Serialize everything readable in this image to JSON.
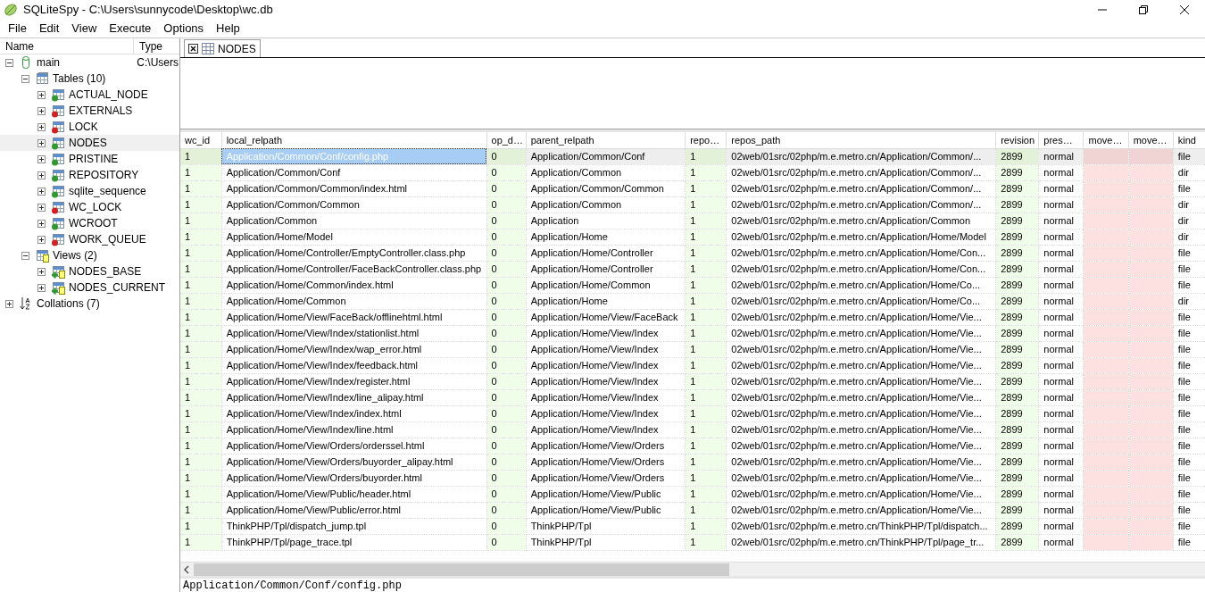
{
  "window": {
    "title": "SQLiteSpy - C:\\Users\\sunnycode\\Desktop\\wc.db"
  },
  "menu": [
    "File",
    "Edit",
    "View",
    "Execute",
    "Options",
    "Help"
  ],
  "schema_tree": {
    "columns": [
      "Name",
      "Type"
    ],
    "items": [
      {
        "label": "main",
        "kind": "database",
        "type": "C:\\Users",
        "expanded": true,
        "selected": false,
        "children": [
          {
            "label": "Tables (10)",
            "kind": "tables",
            "expanded": true,
            "selected": false,
            "children": [
              {
                "label": "ACTUAL_NODE",
                "kind": "table",
                "color": "#2e9a2e",
                "expanded": false,
                "selected": false
              },
              {
                "label": "EXTERNALS",
                "kind": "table",
                "color": "#d02020",
                "expanded": false,
                "selected": false
              },
              {
                "label": "LOCK",
                "kind": "table",
                "color": "#d02020",
                "expanded": false,
                "selected": false
              },
              {
                "label": "NODES",
                "kind": "table",
                "color": "#2e9a2e",
                "expanded": false,
                "selected": true
              },
              {
                "label": "PRISTINE",
                "kind": "table",
                "color": "#2e9a2e",
                "expanded": false,
                "selected": false
              },
              {
                "label": "REPOSITORY",
                "kind": "table",
                "color": "#2e9a2e",
                "expanded": false,
                "selected": false
              },
              {
                "label": "sqlite_sequence",
                "kind": "table",
                "color": "#2e9a2e",
                "expanded": false,
                "selected": false
              },
              {
                "label": "WC_LOCK",
                "kind": "table",
                "color": "#d02020",
                "expanded": false,
                "selected": false
              },
              {
                "label": "WCROOT",
                "kind": "table",
                "color": "#2e9a2e",
                "expanded": false,
                "selected": false
              },
              {
                "label": "WORK_QUEUE",
                "kind": "table",
                "color": "#d02020",
                "expanded": false,
                "selected": false
              }
            ]
          },
          {
            "label": "Views (2)",
            "kind": "views",
            "expanded": true,
            "selected": false,
            "children": [
              {
                "label": "NODES_BASE",
                "kind": "view",
                "expanded": false,
                "selected": false
              },
              {
                "label": "NODES_CURRENT",
                "kind": "view",
                "expanded": false,
                "selected": false
              }
            ]
          }
        ]
      },
      {
        "label": "Collations (7)",
        "kind": "collations",
        "expanded": false,
        "selected": false
      }
    ]
  },
  "tabs": [
    {
      "label": "NODES",
      "selected": true
    }
  ],
  "grid": {
    "columns": [
      {
        "label": "wc_id",
        "kind": "integer"
      },
      {
        "label": "local_relpath",
        "kind": "text"
      },
      {
        "label": "op_d…",
        "kind": "integer"
      },
      {
        "label": "parent_relpath",
        "kind": "text"
      },
      {
        "label": "repo…",
        "kind": "integer"
      },
      {
        "label": "repos_path",
        "kind": "text"
      },
      {
        "label": "revision",
        "kind": "integer"
      },
      {
        "label": "pres…",
        "kind": "text"
      },
      {
        "label": "move…",
        "kind": "null"
      },
      {
        "label": "move…",
        "kind": "null"
      },
      {
        "label": "kind",
        "kind": "text"
      }
    ],
    "rows": [
      {
        "selected": true,
        "cells": [
          "1",
          "Application/Common/Conf/config.php",
          "0",
          "Application/Common/Conf",
          "1",
          "02web/01src/02php/m.e.metro.cn/Application/Common/...",
          "2899",
          "normal",
          null,
          null,
          "file"
        ]
      },
      {
        "selected": false,
        "cells": [
          "1",
          "Application/Common/Conf",
          "0",
          "Application/Common",
          "1",
          "02web/01src/02php/m.e.metro.cn/Application/Common/...",
          "2899",
          "normal",
          null,
          null,
          "dir"
        ]
      },
      {
        "selected": false,
        "cells": [
          "1",
          "Application/Common/Common/index.html",
          "0",
          "Application/Common/Common",
          "1",
          "02web/01src/02php/m.e.metro.cn/Application/Common/...",
          "2899",
          "normal",
          null,
          null,
          "file"
        ]
      },
      {
        "selected": false,
        "cells": [
          "1",
          "Application/Common/Common",
          "0",
          "Application/Common",
          "1",
          "02web/01src/02php/m.e.metro.cn/Application/Common/...",
          "2899",
          "normal",
          null,
          null,
          "dir"
        ]
      },
      {
        "selected": false,
        "cells": [
          "1",
          "Application/Common",
          "0",
          "Application",
          "1",
          "02web/01src/02php/m.e.metro.cn/Application/Common",
          "2899",
          "normal",
          null,
          null,
          "dir"
        ]
      },
      {
        "selected": false,
        "cells": [
          "1",
          "Application/Home/Model",
          "0",
          "Application/Home",
          "1",
          "02web/01src/02php/m.e.metro.cn/Application/Home/Model",
          "2899",
          "normal",
          null,
          null,
          "dir"
        ]
      },
      {
        "selected": false,
        "cells": [
          "1",
          "Application/Home/Controller/EmptyController.class.php",
          "0",
          "Application/Home/Controller",
          "1",
          "02web/01src/02php/m.e.metro.cn/Application/Home/Con...",
          "2899",
          "normal",
          null,
          null,
          "file"
        ]
      },
      {
        "selected": false,
        "cells": [
          "1",
          "Application/Home/Controller/FaceBackController.class.php",
          "0",
          "Application/Home/Controller",
          "1",
          "02web/01src/02php/m.e.metro.cn/Application/Home/Con...",
          "2899",
          "normal",
          null,
          null,
          "file"
        ]
      },
      {
        "selected": false,
        "cells": [
          "1",
          "Application/Home/Common/index.html",
          "0",
          "Application/Home/Common",
          "1",
          "02web/01src/02php/m.e.metro.cn/Application/Home/Co...",
          "2899",
          "normal",
          null,
          null,
          "file"
        ]
      },
      {
        "selected": false,
        "cells": [
          "1",
          "Application/Home/Common",
          "0",
          "Application/Home",
          "1",
          "02web/01src/02php/m.e.metro.cn/Application/Home/Co...",
          "2899",
          "normal",
          null,
          null,
          "dir"
        ]
      },
      {
        "selected": false,
        "cells": [
          "1",
          "Application/Home/View/FaceBack/offlinehtml.html",
          "0",
          "Application/Home/View/FaceBack",
          "1",
          "02web/01src/02php/m.e.metro.cn/Application/Home/Vie...",
          "2899",
          "normal",
          null,
          null,
          "file"
        ]
      },
      {
        "selected": false,
        "cells": [
          "1",
          "Application/Home/View/Index/stationlist.html",
          "0",
          "Application/Home/View/Index",
          "1",
          "02web/01src/02php/m.e.metro.cn/Application/Home/Vie...",
          "2899",
          "normal",
          null,
          null,
          "file"
        ]
      },
      {
        "selected": false,
        "cells": [
          "1",
          "Application/Home/View/Index/wap_error.html",
          "0",
          "Application/Home/View/Index",
          "1",
          "02web/01src/02php/m.e.metro.cn/Application/Home/Vie...",
          "2899",
          "normal",
          null,
          null,
          "file"
        ]
      },
      {
        "selected": false,
        "cells": [
          "1",
          "Application/Home/View/Index/feedback.html",
          "0",
          "Application/Home/View/Index",
          "1",
          "02web/01src/02php/m.e.metro.cn/Application/Home/Vie...",
          "2899",
          "normal",
          null,
          null,
          "file"
        ]
      },
      {
        "selected": false,
        "cells": [
          "1",
          "Application/Home/View/Index/register.html",
          "0",
          "Application/Home/View/Index",
          "1",
          "02web/01src/02php/m.e.metro.cn/Application/Home/Vie...",
          "2899",
          "normal",
          null,
          null,
          "file"
        ]
      },
      {
        "selected": false,
        "cells": [
          "1",
          "Application/Home/View/Index/line_alipay.html",
          "0",
          "Application/Home/View/Index",
          "1",
          "02web/01src/02php/m.e.metro.cn/Application/Home/Vie...",
          "2899",
          "normal",
          null,
          null,
          "file"
        ]
      },
      {
        "selected": false,
        "cells": [
          "1",
          "Application/Home/View/Index/index.html",
          "0",
          "Application/Home/View/Index",
          "1",
          "02web/01src/02php/m.e.metro.cn/Application/Home/Vie...",
          "2899",
          "normal",
          null,
          null,
          "file"
        ]
      },
      {
        "selected": false,
        "cells": [
          "1",
          "Application/Home/View/Index/line.html",
          "0",
          "Application/Home/View/Index",
          "1",
          "02web/01src/02php/m.e.metro.cn/Application/Home/Vie...",
          "2899",
          "normal",
          null,
          null,
          "file"
        ]
      },
      {
        "selected": false,
        "cells": [
          "1",
          "Application/Home/View/Orders/orderssel.html",
          "0",
          "Application/Home/View/Orders",
          "1",
          "02web/01src/02php/m.e.metro.cn/Application/Home/Vie...",
          "2899",
          "normal",
          null,
          null,
          "file"
        ]
      },
      {
        "selected": false,
        "cells": [
          "1",
          "Application/Home/View/Orders/buyorder_alipay.html",
          "0",
          "Application/Home/View/Orders",
          "1",
          "02web/01src/02php/m.e.metro.cn/Application/Home/Vie...",
          "2899",
          "normal",
          null,
          null,
          "file"
        ]
      },
      {
        "selected": false,
        "cells": [
          "1",
          "Application/Home/View/Orders/buyorder.html",
          "0",
          "Application/Home/View/Orders",
          "1",
          "02web/01src/02php/m.e.metro.cn/Application/Home/Vie...",
          "2899",
          "normal",
          null,
          null,
          "file"
        ]
      },
      {
        "selected": false,
        "cells": [
          "1",
          "Application/Home/View/Public/header.html",
          "0",
          "Application/Home/View/Public",
          "1",
          "02web/01src/02php/m.e.metro.cn/Application/Home/Vie...",
          "2899",
          "normal",
          null,
          null,
          "file"
        ]
      },
      {
        "selected": false,
        "cells": [
          "1",
          "Application/Home/View/Public/error.html",
          "0",
          "Application/Home/View/Public",
          "1",
          "02web/01src/02php/m.e.metro.cn/Application/Home/Vie...",
          "2899",
          "normal",
          null,
          null,
          "file"
        ]
      },
      {
        "selected": false,
        "cells": [
          "1",
          "ThinkPHP/Tpl/dispatch_jump.tpl",
          "0",
          "ThinkPHP/Tpl",
          "1",
          "02web/01src/02php/m.e.metro.cn/ThinkPHP/Tpl/dispatch...",
          "2899",
          "normal",
          null,
          null,
          "file"
        ]
      },
      {
        "selected": false,
        "cells": [
          "1",
          "ThinkPHP/Tpl/page_trace.tpl",
          "0",
          "ThinkPHP/Tpl",
          "1",
          "02web/01src/02php/m.e.metro.cn/ThinkPHP/Tpl/page_tr...",
          "2899",
          "normal",
          null,
          null,
          "file"
        ]
      }
    ]
  },
  "cell_viewer": {
    "text": "Application/Common/Conf/config.php"
  }
}
